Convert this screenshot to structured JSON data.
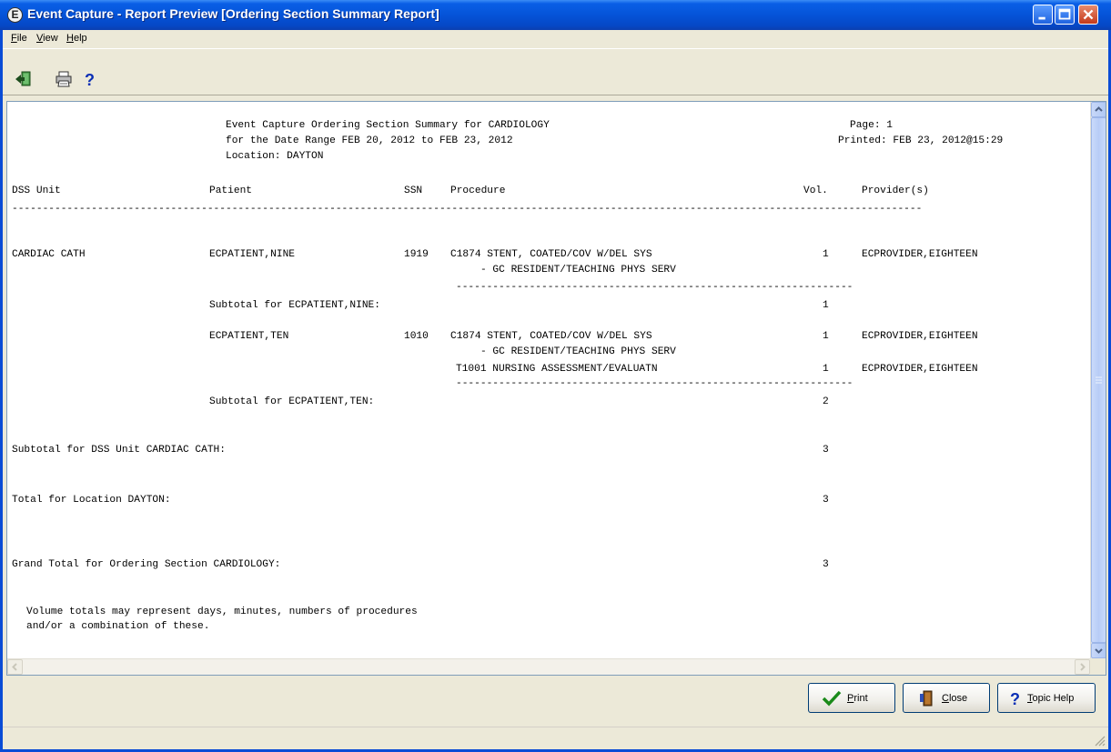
{
  "window": {
    "title": "Event Capture - Report Preview [Ordering Section Summary Report]"
  },
  "menu": {
    "file": "ile",
    "file_accel": "F",
    "view": "iew",
    "view_accel": "V",
    "help": "elp",
    "help_accel": "H"
  },
  "toolbar": {
    "icons": [
      "exit-icon",
      "printer-icon",
      "help-icon"
    ]
  },
  "report": {
    "header_line1": "Event Capture Ordering Section Summary for CARDIOLOGY",
    "header_line2": "for the Date Range FEB 20, 2012 to FEB 23, 2012",
    "header_line3": "Location: DAYTON",
    "page": "Page: 1",
    "printed": "Printed: FEB 23, 2012@15:29",
    "columns": {
      "dss_unit": "DSS Unit",
      "patient": "Patient",
      "ssn": "SSN",
      "procedure": "Procedure",
      "vol": "Vol.",
      "providers": "Provider(s)"
    },
    "divider": "-----------------------------------------------------------------------------------------------------------------------------------------------------",
    "subdivider": "-----------------------------------------------------------------",
    "dss_unit": "CARDIAC CATH",
    "patients": [
      {
        "name": "ECPATIENT,NINE",
        "ssn": "1919",
        "procedures": [
          {
            "line": "C1874 STENT, COATED/COV W/DEL SYS",
            "modifier": "- GC RESIDENT/TEACHING PHYS SERV",
            "vol": "1",
            "provider": "ECPROVIDER,EIGHTEEN"
          }
        ],
        "subtotal_label": "Subtotal for ECPATIENT,NINE:",
        "subtotal": "1"
      },
      {
        "name": "ECPATIENT,TEN",
        "ssn": "1010",
        "procedures": [
          {
            "line": "C1874 STENT, COATED/COV W/DEL SYS",
            "modifier": "- GC RESIDENT/TEACHING PHYS SERV",
            "vol": "1",
            "provider": "ECPROVIDER,EIGHTEEN"
          },
          {
            "line": "T1001 NURSING ASSESSMENT/EVALUATN",
            "modifier": "",
            "vol": "1",
            "provider": "ECPROVIDER,EIGHTEEN"
          }
        ],
        "subtotal_label": "Subtotal for ECPATIENT,TEN:",
        "subtotal": "2"
      }
    ],
    "dss_subtotal_label": "Subtotal for DSS Unit CARDIAC CATH:",
    "dss_subtotal": "3",
    "location_total_label": "Total for Location DAYTON:",
    "location_total": "3",
    "grand_total_label": "Grand Total for Ordering Section CARDIOLOGY:",
    "grand_total": "3",
    "footnote_line1": "Volume totals may represent days, minutes, numbers of procedures",
    "footnote_line2": "and/or a combination of these."
  },
  "buttons": {
    "print_accel": "P",
    "print": "rint",
    "close_accel": "C",
    "close": "lose",
    "topic_help_accel": "T",
    "topic_help": "opic Help"
  }
}
